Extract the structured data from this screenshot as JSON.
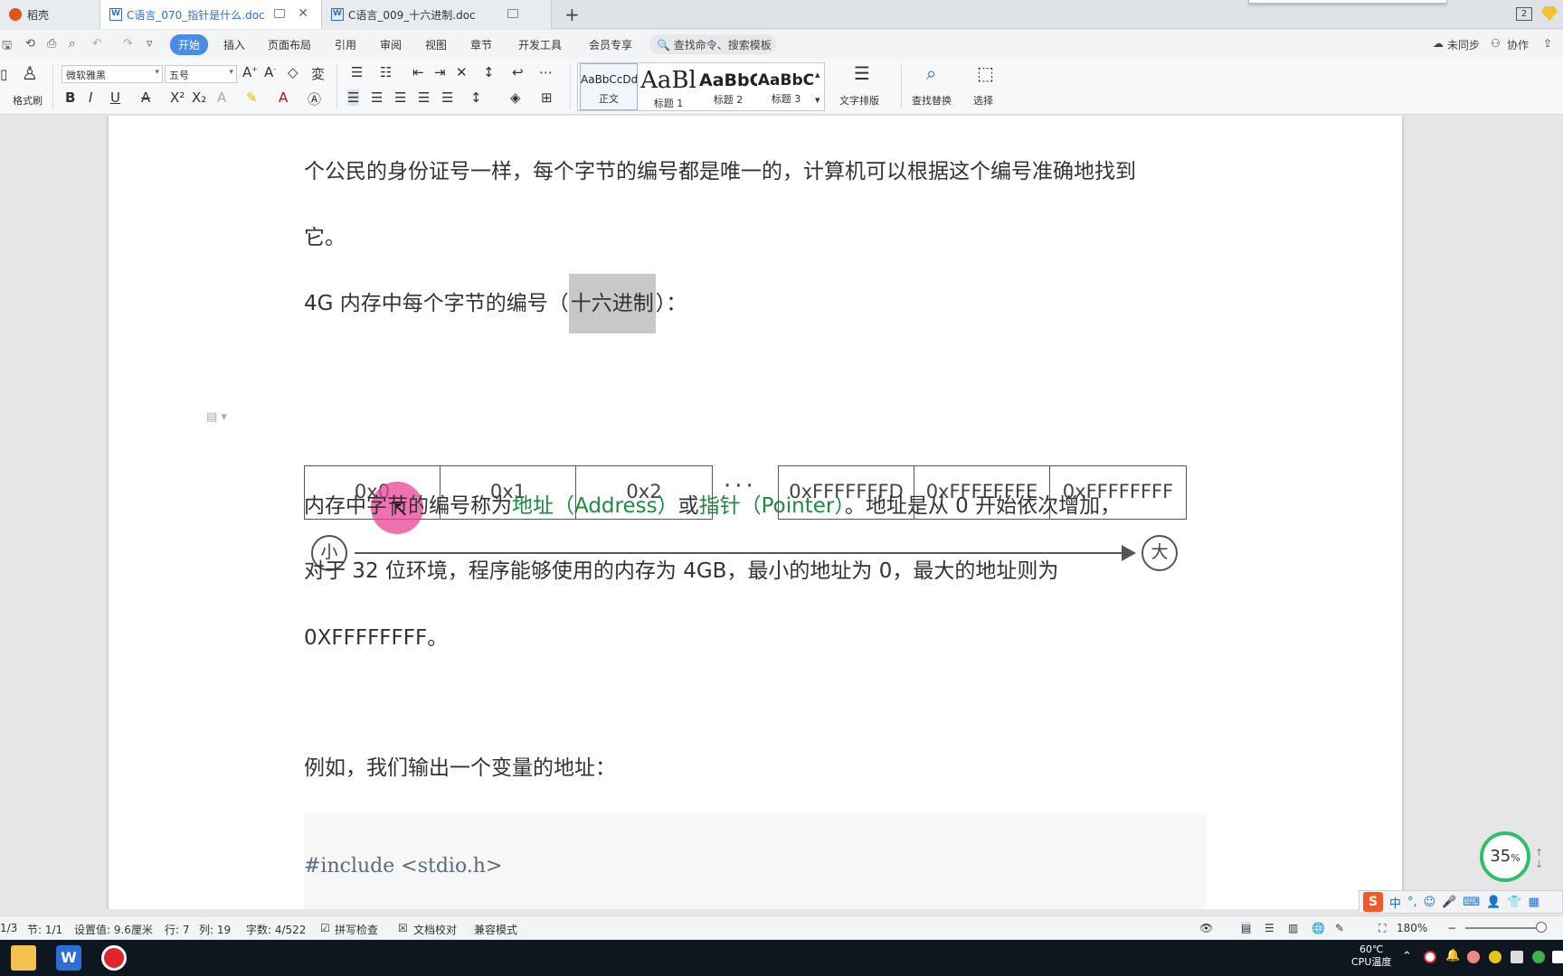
{
  "tabs": {
    "home": "稻壳",
    "doc1": "C语言_070_指针是什么.doc",
    "doc2": "C语言_009_十六进制.doc",
    "new_tab": "+",
    "window_count": "2"
  },
  "menu": {
    "items": [
      "开始",
      "插入",
      "页面布局",
      "引用",
      "审阅",
      "视图",
      "章节",
      "开发工具",
      "会员专享"
    ],
    "search_placeholder": "查找命令、搜索模板",
    "right": [
      "未同步",
      "协作"
    ]
  },
  "ribbon": {
    "format_painter": "格式刷",
    "font_name": "微软雅黑",
    "font_size": "五号",
    "styles": [
      {
        "preview": "AaBbCcDd",
        "name": "正文"
      },
      {
        "preview": "AaBl",
        "name": "标题 1"
      },
      {
        "preview": "AaBbC",
        "name": "标题 2"
      },
      {
        "preview": "AaBbC",
        "name": "标题 3"
      }
    ],
    "text_layout": "文字排版",
    "find_replace": "查找替换",
    "select": "选择"
  },
  "document": {
    "line1": "个公民的身份证号一样，每个字节的编号都是唯一的，计算机可以根据这个编号准确地找到",
    "line2": "它。",
    "heading_pre": "4G  内存中每个字节的编号（",
    "heading_hl": "十六进制",
    "heading_post": "）：",
    "memory_cells": [
      "0x0",
      "0x1",
      "0x2",
      "0xFFFFFFFD",
      "0xFFFFFFFE",
      "0xFFFFFFFF"
    ],
    "ellipsis": "···",
    "small_label": "小",
    "big_label": "大",
    "p2_a": "内存中字节的编号称为",
    "p2_addr": "地址（Address）",
    "p2_or": "或",
    "p2_ptr": "指针（Pointer）",
    "p2_b": "。地址是从  0  开始依次增加，",
    "p3": "对于  32  位环境，程序能够使用的内存为  4GB，最小的地址为  0，最大的地址则为",
    "p4": "0XFFFFFFFF。",
    "p5": "例如，我们输出一个变量的地址：",
    "code_line": "#include <stdio.h>"
  },
  "overlay": {
    "progress_value": "35",
    "progress_unit": "%",
    "ime_chars": [
      "中",
      "°,"
    ]
  },
  "statusbar": {
    "page": "1/3",
    "section": "节: 1/1",
    "setting": "设置值: 9.6厘米",
    "row": "行: 7",
    "col": "列: 19",
    "wordcount": "字数: 4/522",
    "spellcheck": "拼写检查",
    "proofread": "文档校对",
    "compat": "兼容模式",
    "zoom": "180%"
  },
  "taskbar": {
    "cpu_temp": "60℃",
    "cpu_label": "CPU温度"
  },
  "colors": {
    "accent": "#4a8be8",
    "green_text": "#1e8a3c",
    "highlight": "#c8c8c8",
    "cursor_highlight": "#ea4196",
    "progress_ring": "#2fbf6a"
  }
}
